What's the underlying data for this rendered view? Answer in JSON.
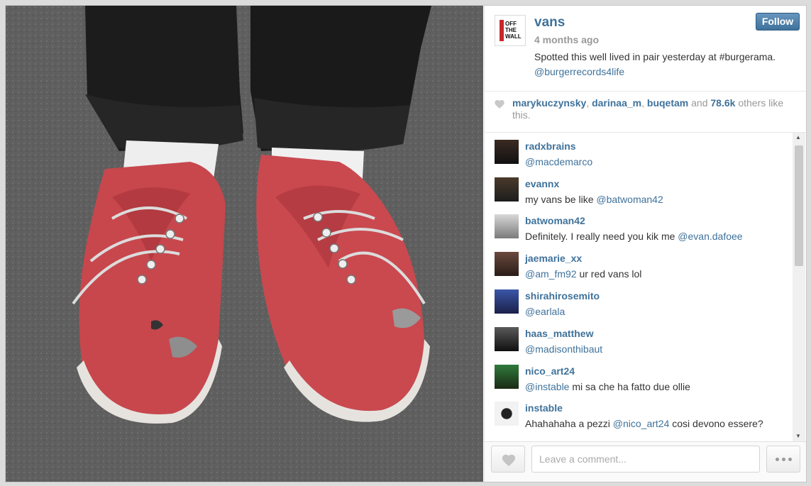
{
  "post": {
    "username": "vans",
    "logo_text": "OFF\nTHE\nWALL",
    "time": "4 months ago",
    "caption": "Spotted this well lived in pair yesterday at #burgerama.",
    "caption_mention": "@burgerrecords4life",
    "follow_label": "Follow"
  },
  "likes": {
    "users": [
      "marykuczynsky",
      "darinaa_m",
      "buqetam"
    ],
    "sep": ", ",
    "and": " and ",
    "count": "78.6k",
    "suffix": " others like this."
  },
  "comments": [
    {
      "user": "radxbrains",
      "text": "",
      "mention": "@macdemarco",
      "text_after": ""
    },
    {
      "user": "evannx",
      "text": "my vans be like ",
      "mention": "@batwoman42",
      "text_after": ""
    },
    {
      "user": "batwoman42",
      "text": "Definitely. I really need you kik me ",
      "mention": "@evan.dafoee",
      "text_after": ""
    },
    {
      "user": "jaemarie_xx",
      "text": "",
      "mention": "@am_fm92",
      "text_after": " ur red vans lol"
    },
    {
      "user": "shirahirosemito",
      "text": "",
      "mention": "@earlala",
      "text_after": ""
    },
    {
      "user": "haas_matthew",
      "text": "",
      "mention": "@madisonthibaut",
      "text_after": ""
    },
    {
      "user": "nico_art24",
      "text": "",
      "mention": "@instable",
      "text_after": " mi sa che ha fatto due ollie"
    },
    {
      "user": "instable",
      "text": "Ahahahaha a pezzi ",
      "mention": "@nico_art24",
      "text_after": " cosi devono essere?"
    }
  ],
  "input": {
    "placeholder": "Leave a comment..."
  },
  "colors": {
    "link": "#3f729b",
    "text": "#333333",
    "muted": "#999999",
    "follow": "#3f729b"
  },
  "icons": [
    "heart-icon",
    "more-dots-icon",
    "scroll-up-icon",
    "scroll-down-icon"
  ]
}
